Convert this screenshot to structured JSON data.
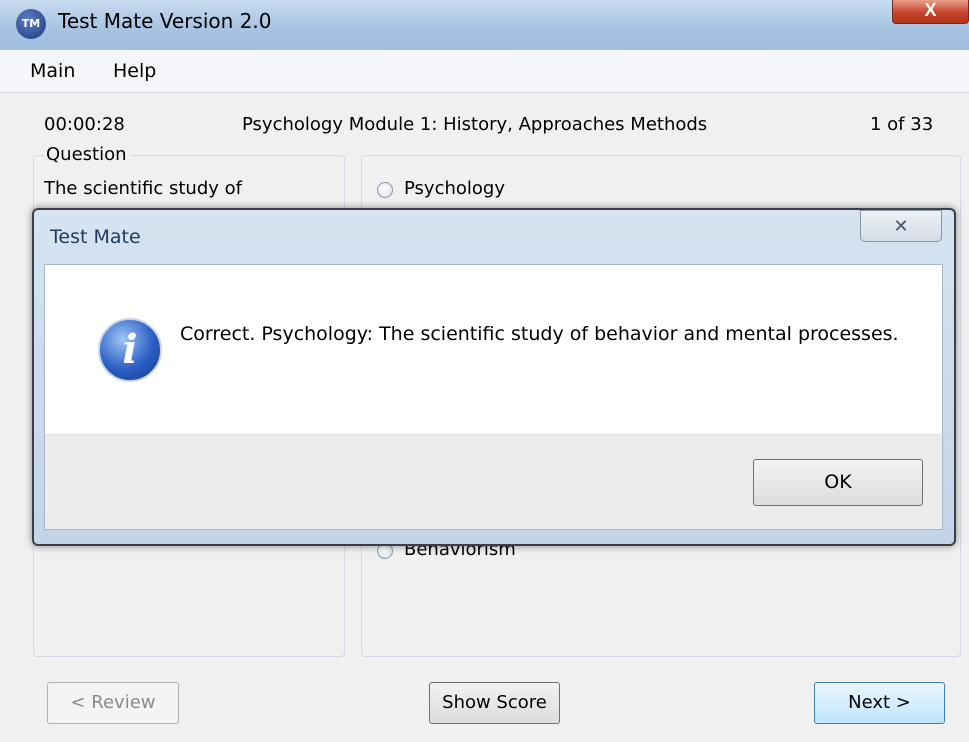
{
  "window": {
    "title": "Test Mate Version 2.0",
    "logo_text": "TM",
    "close_glyph": "X"
  },
  "menu": {
    "items": [
      "Main",
      "Help"
    ]
  },
  "status": {
    "timer": "00:00:28",
    "module": "Psychology Module 1: History, Approaches  Methods",
    "progress": "1 of 33"
  },
  "question": {
    "legend": "Question",
    "text": "The scientific study of"
  },
  "answers": [
    {
      "label": "Psychology"
    },
    {
      "label": "Behaviorism"
    }
  ],
  "buttons": {
    "review": "< Review",
    "show_score": "Show Score",
    "next": "Next >"
  },
  "dialog": {
    "title": "Test Mate",
    "close_glyph": "✕",
    "icon_glyph": "i",
    "message": "Correct. Psychology: The scientific study of behavior and mental processes.",
    "ok": "OK"
  },
  "colors": {
    "titlebar": "#a9c4e3",
    "close_button": "#c7432a",
    "next_button_border": "#3c7fb1"
  },
  "icons": [
    "app-logo-icon",
    "close-icon",
    "info-icon",
    "dialog-close-icon",
    "radio-icon"
  ]
}
